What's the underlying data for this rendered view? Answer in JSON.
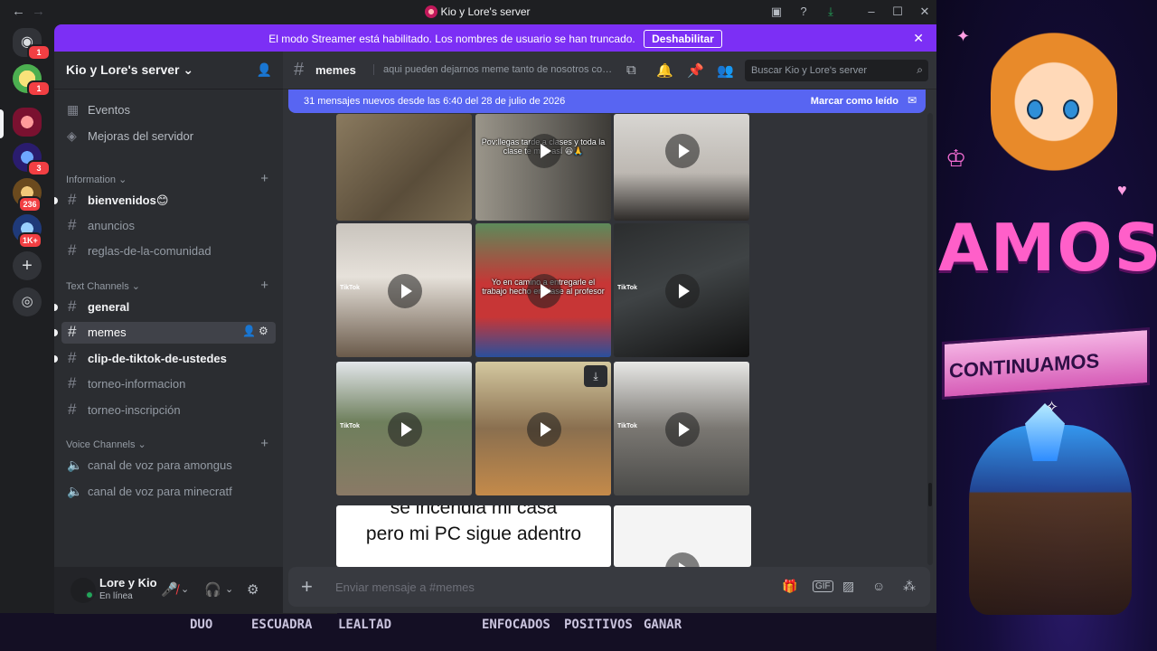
{
  "window": {
    "title": "Kio y Lore's server"
  },
  "streamer": {
    "text": "El modo Streamer está habilitado. Los nombres de usuario se han truncado.",
    "button": "Deshabilitar"
  },
  "rail": {
    "badges": [
      "1",
      "1",
      "3",
      "236",
      "1K+"
    ]
  },
  "server": {
    "name": "Kio y Lore's server",
    "top_items": [
      "Eventos",
      "Mejoras del servidor"
    ],
    "categories": [
      "Information",
      "Text Channels",
      "Voice Channels"
    ],
    "info_channels": [
      "bienvenidos😊",
      "anuncios",
      "reglas-de-la-comunidad"
    ],
    "text_channels": [
      "general",
      "memes",
      "clip-de-tiktok-de-ustedes",
      "torneo-informacion",
      "torneo-inscripción"
    ],
    "voice_channels": [
      "canal de voz para amongus",
      "canal de voz para minecratf"
    ]
  },
  "user": {
    "name": "Lore y Kio",
    "status": "En línea"
  },
  "channel": {
    "name": "memes",
    "topic": "aqui pueden dejarnos meme tanto de nosotros com...",
    "search_placeholder": "Buscar Kio y Lore's server",
    "new_messages": "31 mensajes nuevos desde las 6:40 del 28 de julio de 2026",
    "mark_read": "Marcar como leído",
    "composer_placeholder": "Enviar mensaje a #memes"
  },
  "media": {
    "captions": [
      "Pov:llegas tarde a clases y toda la clase te mira así 😆🙏",
      "Yo en camino a entregarle el trabajo hecho en clase al profesor"
    ],
    "watermarks": [
      "TikTok",
      "TikTok",
      "TikTok",
      "TikTok"
    ],
    "meme_text": [
      "se incendia mi casa",
      "pero mi PC sigue adentro"
    ]
  },
  "background": {
    "big_text": "AMOS",
    "banner": "CONTINUAMOS",
    "bottom_items": [
      "DUO",
      "ESCUADRA",
      "LEALTAD",
      "ENFOCADOS",
      "POSITIVOS",
      "GANAR"
    ]
  },
  "colors": {
    "blurple": "#5865f2",
    "streamer": "#7c2ff5",
    "online": "#23a55a",
    "badge": "#f23f43"
  }
}
